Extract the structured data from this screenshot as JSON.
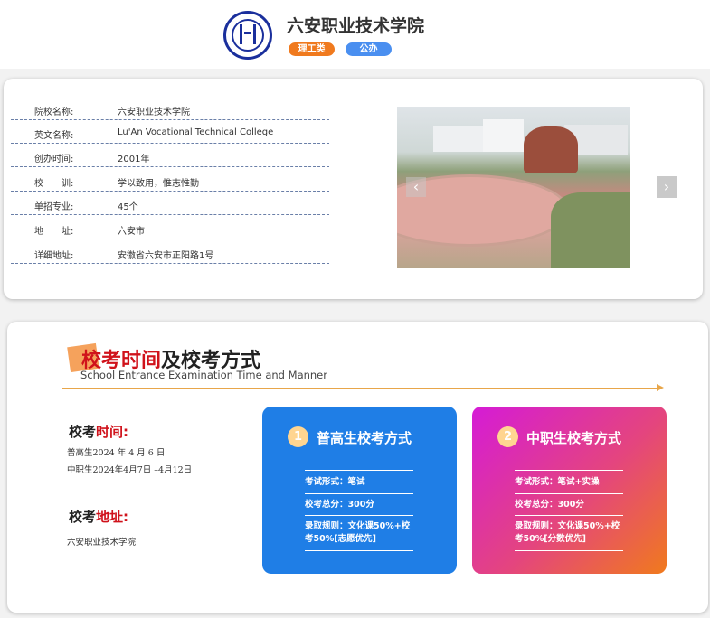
{
  "header": {
    "school_name": "六安职业技术学院",
    "badges": [
      "理工类",
      "公办"
    ]
  },
  "info": {
    "rows": [
      {
        "key": "院校名称:",
        "value": "六安职业技术学院"
      },
      {
        "key": "英文名称:",
        "value": "Lu'An Vocational Technical College"
      },
      {
        "key": "创办时间:",
        "value": "2001年"
      },
      {
        "key": "校　　训:",
        "value": "学以致用，惟志惟勤"
      },
      {
        "key": "单招专业:",
        "value": "45个"
      },
      {
        "key": "地　　址:",
        "value": "六安市"
      },
      {
        "key": "详细地址:",
        "value": "安徽省六安市正阳路1号"
      }
    ],
    "carousel": {
      "prev_icon": "‹",
      "next_icon": "›"
    }
  },
  "exam": {
    "title_red": "校考时间",
    "title_black": "及校考方式",
    "subtitle": "School Entrance Examination Time and Manner",
    "time_label": {
      "black": "校考",
      "red": "时间:"
    },
    "time_lines": [
      "普高生2024 年 4 月 6 日",
      "中职生2024年4月7日 –4月12日"
    ],
    "addr_label": {
      "black": "校考",
      "red": "地址:"
    },
    "address": "六安职业技术学院",
    "boxes": [
      {
        "num": "1",
        "title": "普高生校考方式",
        "items": [
          "考试形式：笔试",
          "校考总分：300分",
          "录取规则：文化课50%+校考50%[志愿优先]"
        ]
      },
      {
        "num": "2",
        "title": "中职生校考方式",
        "items": [
          "考试形式：笔试+实操",
          "校考总分：300分",
          "录取规则：文化课50%+校考50%[分数优先]"
        ]
      }
    ]
  },
  "colors": {
    "accent_orange": "#f07a1e",
    "accent_blue": "#4a8ff0",
    "title_red": "#d0121b",
    "box_blue": "#1f7ee6"
  }
}
